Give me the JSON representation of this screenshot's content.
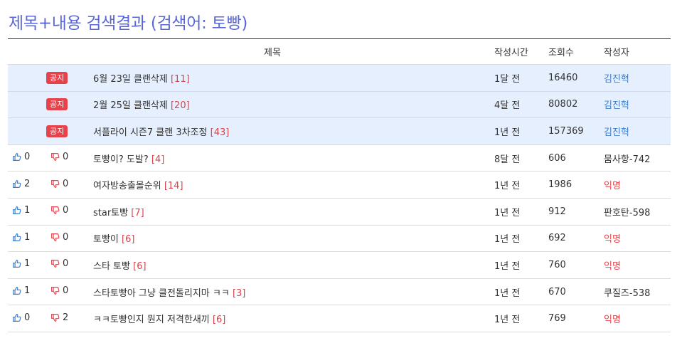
{
  "page": {
    "title": "제목+내용 검색결과",
    "query": "(검색어: 토빵)"
  },
  "columns": {
    "title": "제목",
    "time": "작성시간",
    "views": "조회수",
    "author": "작성자"
  },
  "colors": {
    "title": "#5b67d8",
    "notice_bg": "#e6effd",
    "badge": "#e8414a",
    "comment_count": "#d9434b",
    "author_link": "#3c7cc9",
    "anonymous": "#e8414a"
  },
  "notices": [
    {
      "badge": "공지",
      "title": "6월 23일 클랜삭제",
      "comments": "[11]",
      "time": "1달 전",
      "views": "16460",
      "author": "김진혁"
    },
    {
      "badge": "공지",
      "title": "2월 25일 클랜삭제",
      "comments": "[20]",
      "time": "4달 전",
      "views": "80802",
      "author": "김진혁"
    },
    {
      "badge": "공지",
      "title": "서플라이 시즌7 클랜 3차조정",
      "comments": "[43]",
      "time": "1년 전",
      "views": "157369",
      "author": "김진혁"
    }
  ],
  "posts": [
    {
      "likes": "0",
      "dislikes": "0",
      "title": "토빵이? 도발?",
      "comments": "[4]",
      "time": "8달 전",
      "views": "606",
      "author": "뭄사항-742",
      "anonymous": false
    },
    {
      "likes": "2",
      "dislikes": "0",
      "title": "여자방송출몰순위",
      "comments": "[14]",
      "time": "1년 전",
      "views": "1986",
      "author": "익명",
      "anonymous": true
    },
    {
      "likes": "1",
      "dislikes": "0",
      "title": "star토빵",
      "comments": "[7]",
      "time": "1년 전",
      "views": "912",
      "author": "판호탄-598",
      "anonymous": false
    },
    {
      "likes": "1",
      "dislikes": "0",
      "title": "토빵이",
      "comments": "[6]",
      "time": "1년 전",
      "views": "692",
      "author": "익명",
      "anonymous": true
    },
    {
      "likes": "1",
      "dislikes": "0",
      "title": "스타 토빵",
      "comments": "[6]",
      "time": "1년 전",
      "views": "760",
      "author": "익명",
      "anonymous": true
    },
    {
      "likes": "1",
      "dislikes": "0",
      "title": "스타토빵아 그냥 클전돌리지마 ㅋㅋ",
      "comments": "[3]",
      "time": "1년 전",
      "views": "670",
      "author": "쿠질즈-538",
      "anonymous": false
    },
    {
      "likes": "0",
      "dislikes": "2",
      "title": "ㅋㅋ토빵인지 뭔지 저격한새끼",
      "comments": "[6]",
      "time": "1년 전",
      "views": "769",
      "author": "익명",
      "anonymous": true
    }
  ],
  "icons": {
    "like": "thumbs-up-icon",
    "dislike": "thumbs-down-icon"
  }
}
